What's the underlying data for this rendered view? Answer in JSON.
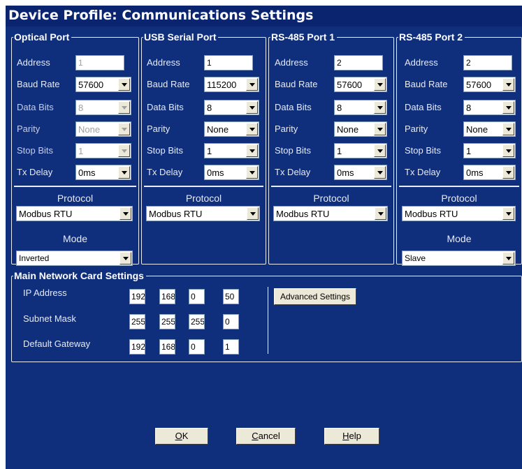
{
  "window": {
    "title": "Device Profile: Communications Settings"
  },
  "labels": {
    "address": "Address",
    "baud_rate": "Baud Rate",
    "data_bits": "Data Bits",
    "parity": "Parity",
    "stop_bits": "Stop Bits",
    "tx_delay": "Tx Delay",
    "protocol": "Protocol",
    "mode": "Mode"
  },
  "ports": [
    {
      "title": "Optical Port",
      "address": "1",
      "baud_rate": "57600",
      "data_bits": "8",
      "parity": "None",
      "stop_bits": "1",
      "tx_delay": "0ms",
      "protocol": "Modbus RTU",
      "mode": "Inverted"
    },
    {
      "title": "USB Serial Port",
      "address": "1",
      "baud_rate": "115200",
      "data_bits": "8",
      "parity": "None",
      "stop_bits": "1",
      "tx_delay": "0ms",
      "protocol": "Modbus RTU"
    },
    {
      "title": "RS-485 Port 1",
      "address": "2",
      "baud_rate": "57600",
      "data_bits": "8",
      "parity": "None",
      "stop_bits": "1",
      "tx_delay": "0ms",
      "protocol": "Modbus RTU"
    },
    {
      "title": "RS-485 Port 2",
      "address": "2",
      "baud_rate": "57600",
      "data_bits": "8",
      "parity": "None",
      "stop_bits": "1",
      "tx_delay": "0ms",
      "protocol": "Modbus RTU",
      "mode": "Slave"
    }
  ],
  "network": {
    "title": "Main Network Card Settings",
    "ip_label": "IP Address",
    "subnet_label": "Subnet Mask",
    "gateway_label": "Default Gateway",
    "ip": [
      "192",
      "168",
      "0",
      "50"
    ],
    "subnet": [
      "255",
      "255",
      "255",
      "0"
    ],
    "gateway": [
      "192",
      "168",
      "0",
      "1"
    ],
    "advanced_label": "Advanced Settings"
  },
  "buttons": {
    "ok_hot": "O",
    "ok_rest": "K",
    "cancel_hot": "C",
    "cancel_rest": "ancel",
    "help_hot": "H",
    "help_rest": "elp"
  }
}
